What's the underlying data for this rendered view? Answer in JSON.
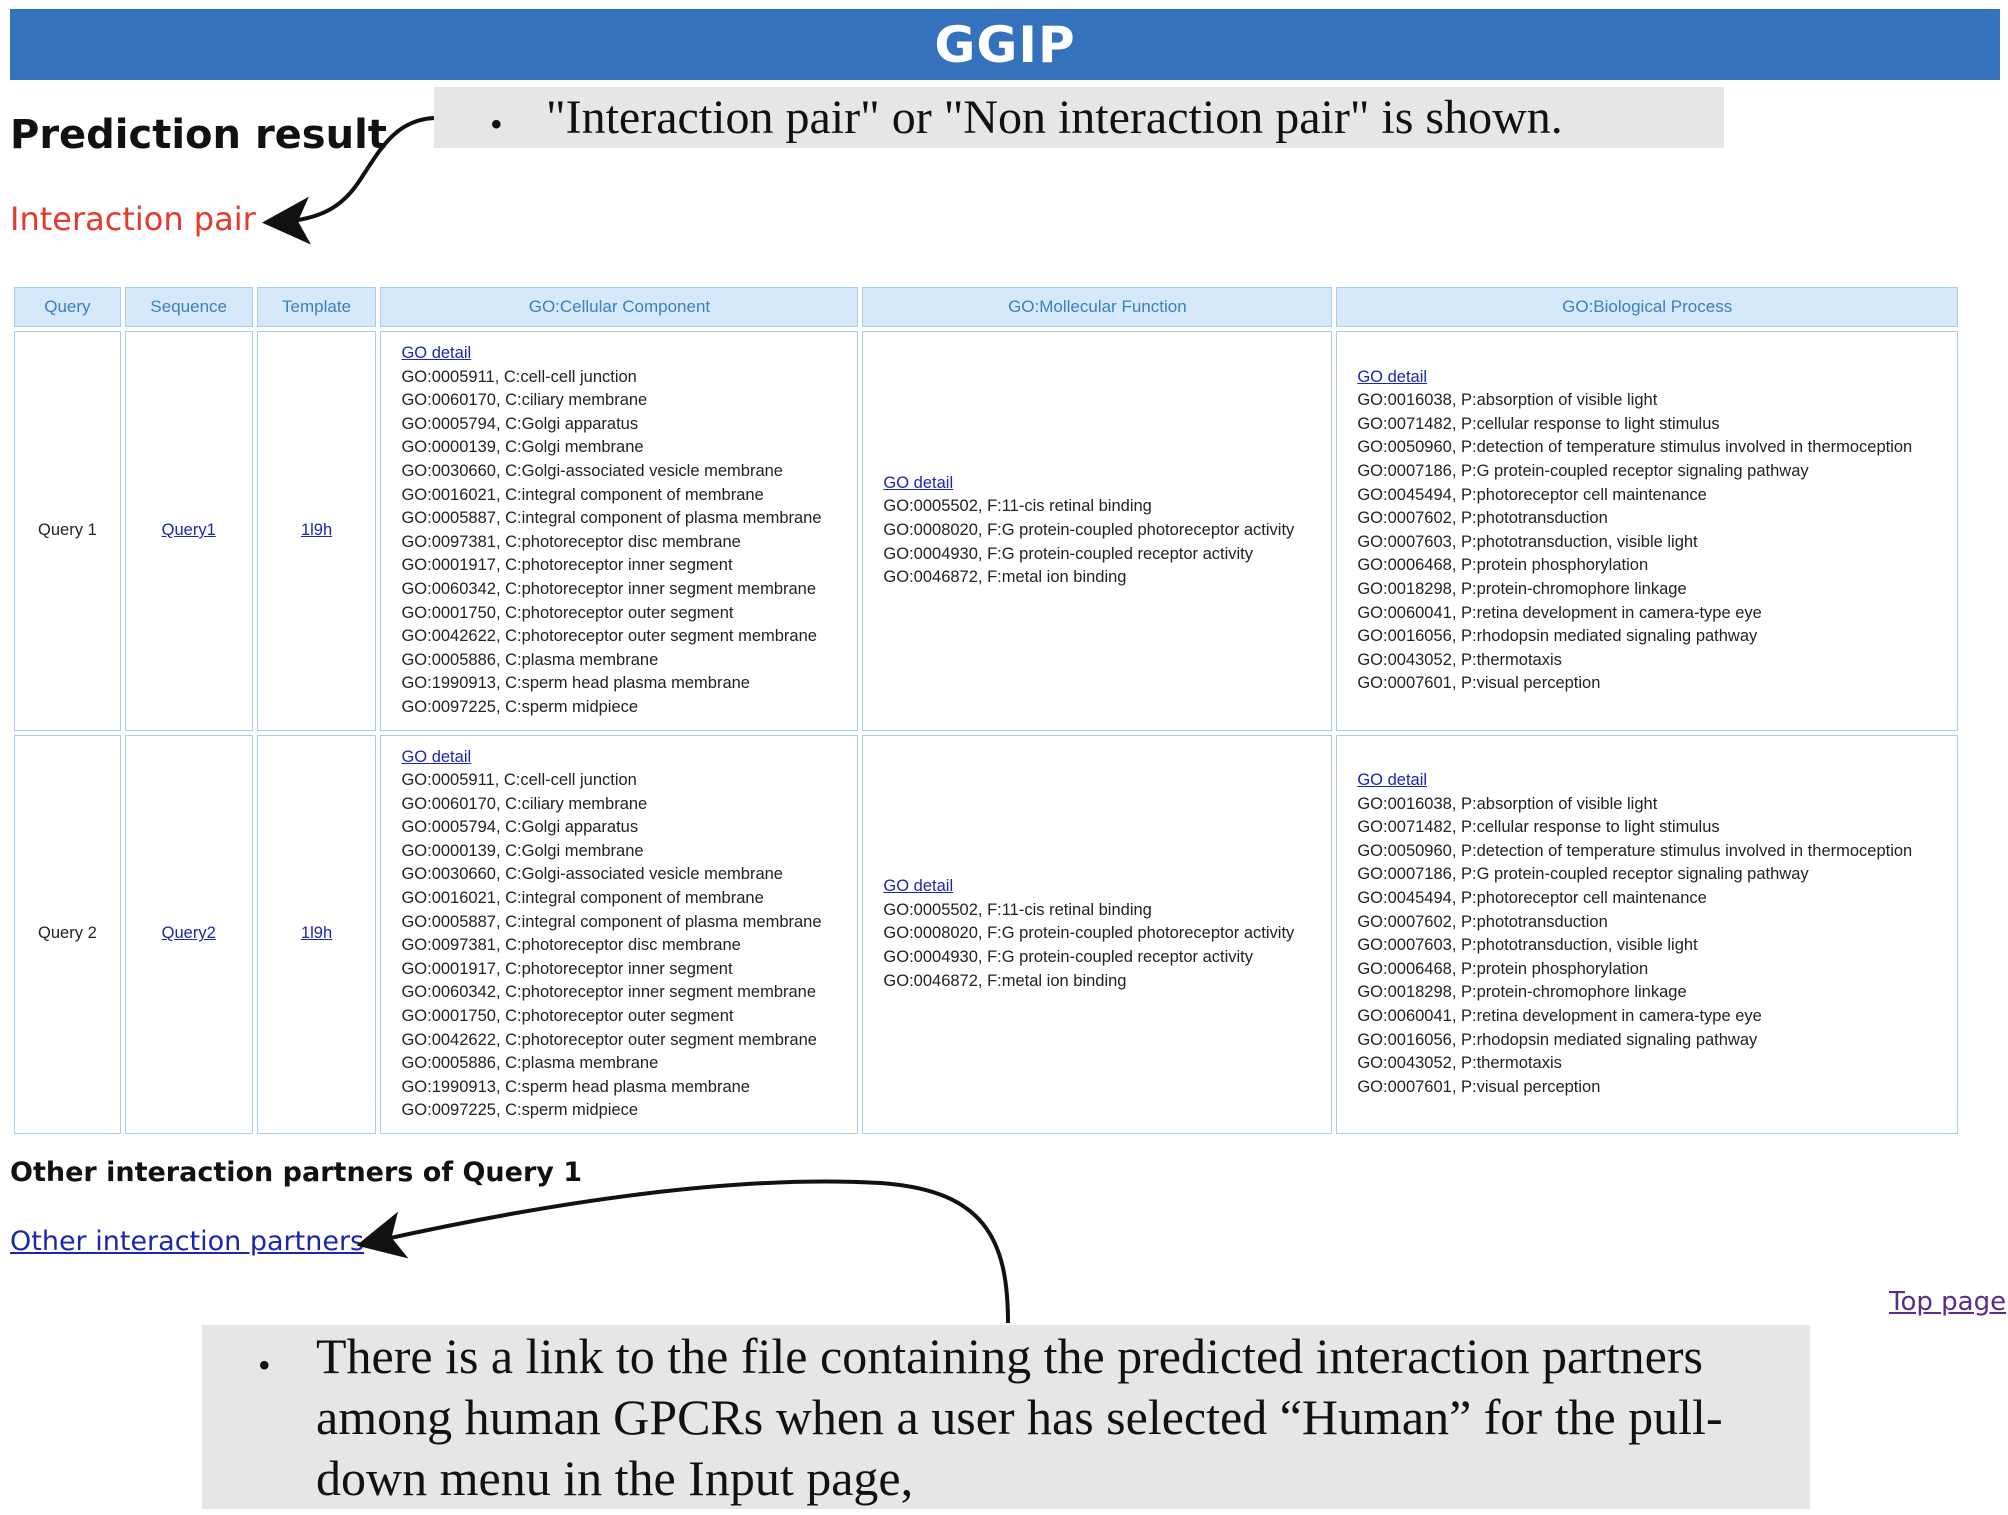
{
  "app": {
    "title": "GGIP"
  },
  "prediction": {
    "heading": "Prediction result",
    "result": "Interaction pair"
  },
  "callouts": {
    "top": "\"Interaction pair\" or \"Non interaction pair\" is shown.",
    "bottom": "There is a link to the file containing the predicted interaction partners among human GPCRs when a user has selected “Human” for the pull-down menu in the Input page,"
  },
  "table": {
    "headers": [
      "Query",
      "Sequence",
      "Template",
      "GO:Cellular Component",
      "GO:Mollecular Function",
      "GO:Biological Process"
    ],
    "rows": [
      {
        "query": "Query 1",
        "sequence": "Query1",
        "template": "1l9h",
        "go_detail": "GO detail",
        "cc": [
          "GO:0005911, C:cell-cell junction",
          "GO:0060170, C:ciliary membrane",
          "GO:0005794, C:Golgi apparatus",
          "GO:0000139, C:Golgi membrane",
          "GO:0030660, C:Golgi-associated vesicle membrane",
          "GO:0016021, C:integral component of membrane",
          "GO:0005887, C:integral component of plasma membrane",
          "GO:0097381, C:photoreceptor disc membrane",
          "GO:0001917, C:photoreceptor inner segment",
          "GO:0060342, C:photoreceptor inner segment membrane",
          "GO:0001750, C:photoreceptor outer segment",
          "GO:0042622, C:photoreceptor outer segment membrane",
          "GO:0005886, C:plasma membrane",
          "GO:1990913, C:sperm head plasma membrane",
          "GO:0097225, C:sperm midpiece"
        ],
        "mf": [
          "GO:0005502, F:11-cis retinal binding",
          "GO:0008020, F:G protein-coupled photoreceptor activity",
          "GO:0004930, F:G protein-coupled receptor activity",
          "GO:0046872, F:metal ion binding"
        ],
        "bp": [
          "GO:0016038, P:absorption of visible light",
          "GO:0071482, P:cellular response to light stimulus",
          "GO:0050960, P:detection of temperature stimulus involved in thermoception",
          "GO:0007186, P:G protein-coupled receptor signaling pathway",
          "GO:0045494, P:photoreceptor cell maintenance",
          "GO:0007602, P:phototransduction",
          "GO:0007603, P:phototransduction, visible light",
          "GO:0006468, P:protein phosphorylation",
          "GO:0018298, P:protein-chromophore linkage",
          "GO:0060041, P:retina development in camera-type eye",
          "GO:0016056, P:rhodopsin mediated signaling pathway",
          "GO:0043052, P:thermotaxis",
          "GO:0007601, P:visual perception"
        ]
      },
      {
        "query": "Query 2",
        "sequence": "Query2",
        "template": "1l9h",
        "go_detail": "GO detail",
        "cc": [
          "GO:0005911, C:cell-cell junction",
          "GO:0060170, C:ciliary membrane",
          "GO:0005794, C:Golgi apparatus",
          "GO:0000139, C:Golgi membrane",
          "GO:0030660, C:Golgi-associated vesicle membrane",
          "GO:0016021, C:integral component of membrane",
          "GO:0005887, C:integral component of plasma membrane",
          "GO:0097381, C:photoreceptor disc membrane",
          "GO:0001917, C:photoreceptor inner segment",
          "GO:0060342, C:photoreceptor inner segment membrane",
          "GO:0001750, C:photoreceptor outer segment",
          "GO:0042622, C:photoreceptor outer segment membrane",
          "GO:0005886, C:plasma membrane",
          "GO:1990913, C:sperm head plasma membrane",
          "GO:0097225, C:sperm midpiece"
        ],
        "mf": [
          "GO:0005502, F:11-cis retinal binding",
          "GO:0008020, F:G protein-coupled photoreceptor activity",
          "GO:0004930, F:G protein-coupled receptor activity",
          "GO:0046872, F:metal ion binding"
        ],
        "bp": [
          "GO:0016038, P:absorption of visible light",
          "GO:0071482, P:cellular response to light stimulus",
          "GO:0050960, P:detection of temperature stimulus involved in thermoception",
          "GO:0007186, P:G protein-coupled receptor signaling pathway",
          "GO:0045494, P:photoreceptor cell maintenance",
          "GO:0007602, P:phototransduction",
          "GO:0007603, P:phototransduction, visible light",
          "GO:0006468, P:protein phosphorylation",
          "GO:0018298, P:protein-chromophore linkage",
          "GO:0060041, P:retina development in camera-type eye",
          "GO:0016056, P:rhodopsin mediated signaling pathway",
          "GO:0043052, P:thermotaxis",
          "GO:0007601, P:visual perception"
        ]
      }
    ]
  },
  "other": {
    "heading": "Other interaction partners of Query 1",
    "link": "Other interaction partners"
  },
  "footer": {
    "top_page": "Top page"
  },
  "colors": {
    "header_bg": "#3572bd",
    "result_red": "#e8382b",
    "link_blue": "#1a26b0",
    "table_header_bg": "#d6e9fb",
    "table_border": "#a9cbec",
    "callout_bg": "#e6e6e6"
  },
  "icons": [
    "bullet-icon",
    "curved-arrow-icon"
  ]
}
